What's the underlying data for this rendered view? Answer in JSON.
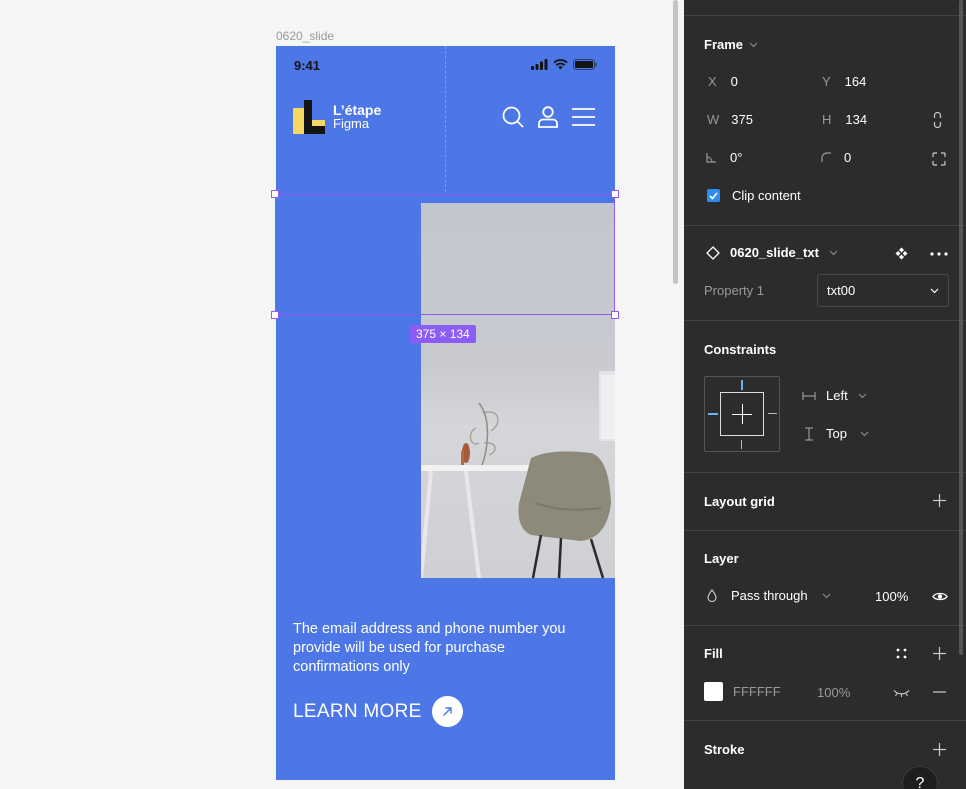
{
  "canvas": {
    "frame_label": "0620_slide",
    "size_badge": "375 × 134"
  },
  "phone": {
    "time": "9:41",
    "brand_name": "L’étape",
    "brand_sub": "Figma",
    "body_text": "The email address and phone number you provide will be used for purchase confirmations only",
    "cta_label": "LEARN MORE",
    "colors": {
      "background": "#4d77e6",
      "logo_yellow": "#f5d862",
      "text": "#ffffff"
    }
  },
  "panel": {
    "frame": {
      "title": "Frame",
      "x_label": "X",
      "x_value": "0",
      "y_label": "Y",
      "y_value": "164",
      "w_label": "W",
      "w_value": "375",
      "h_label": "H",
      "h_value": "134",
      "rotation_value": "0°",
      "radius_value": "0",
      "clip_label": "Clip content"
    },
    "component": {
      "name": "0620_slide_txt",
      "property_label": "Property 1",
      "property_value": "txt00"
    },
    "constraints": {
      "title": "Constraints",
      "horizontal": "Left",
      "vertical": "Top"
    },
    "layout_grid": {
      "title": "Layout grid"
    },
    "layer": {
      "title": "Layer",
      "blend": "Pass through",
      "opacity": "100%"
    },
    "fill": {
      "title": "Fill",
      "hex": "FFFFFF",
      "opacity": "100%"
    },
    "stroke": {
      "title": "Stroke"
    },
    "help": "?"
  },
  "icons": [
    "signal-icon",
    "wifi-icon",
    "battery-icon",
    "search-icon",
    "user-icon",
    "menu-icon",
    "arrow-up-right-icon",
    "chevron-down-icon",
    "component-icon",
    "more-icon",
    "eye-icon",
    "eye-closed-icon",
    "plus-icon",
    "minus-icon",
    "grid-dots-icon",
    "blend-drop-icon",
    "constrain-proportions-icon",
    "resize-icon"
  ]
}
